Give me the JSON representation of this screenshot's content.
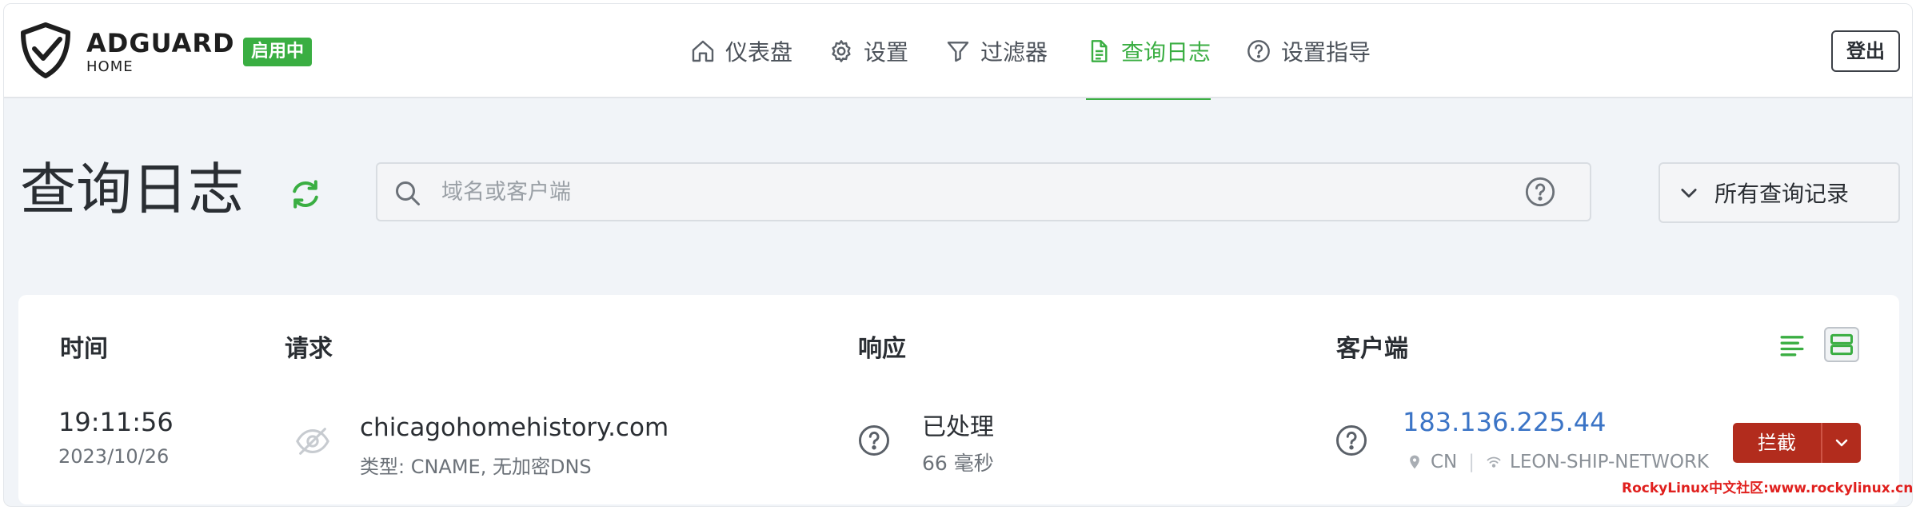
{
  "header": {
    "brand": "ADGUARD",
    "brand_sub": "HOME",
    "status_badge": "启用中",
    "nav": [
      {
        "label": "仪表盘",
        "icon": "home-icon"
      },
      {
        "label": "设置",
        "icon": "gear-icon"
      },
      {
        "label": "过滤器",
        "icon": "filter-icon"
      },
      {
        "label": "查询日志",
        "icon": "document-icon",
        "active": true
      },
      {
        "label": "设置指导",
        "icon": "help-icon"
      }
    ],
    "logout_label": "登出"
  },
  "page": {
    "title": "查询日志",
    "search_placeholder": "域名或客户端",
    "filter_selected": "所有查询记录"
  },
  "table": {
    "columns": [
      "时间",
      "请求",
      "响应",
      "客户端"
    ],
    "rows": [
      {
        "time": "19:11:56",
        "date": "2023/10/26",
        "domain": "chicagohomehistory.com",
        "type_info": "类型: CNAME, 无加密DNS",
        "status": "已处理",
        "elapsed": "66 毫秒",
        "client_ip": "183.136.225.44",
        "client_country": "CN",
        "client_network": "LEON-SHIP-NETWORK",
        "block_label": "拦截"
      }
    ]
  },
  "watermark": "RockyLinux中文社区:www.rockylinux.cn",
  "colors": {
    "accent_green": "#3aae42",
    "link_blue": "#3b74c6",
    "block_red": "#b22c1d"
  }
}
